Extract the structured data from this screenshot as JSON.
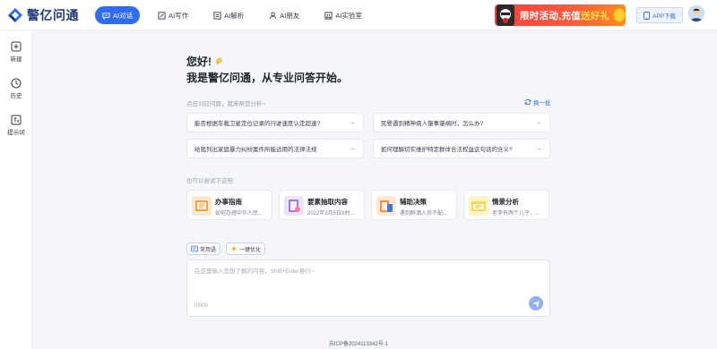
{
  "header": {
    "logo_text": "警亿问通",
    "nav": [
      {
        "label": "AI对话",
        "icon": "chat-bubble-icon",
        "active": true
      },
      {
        "label": "AI写作",
        "icon": "pen-icon",
        "active": false
      },
      {
        "label": "AI解析",
        "icon": "document-icon",
        "active": false
      },
      {
        "label": "AI朋友",
        "icon": "users-icon",
        "active": false
      },
      {
        "label": "AI实验室",
        "icon": "lab-icon",
        "active": false
      }
    ],
    "promo": {
      "text_main": "限时活动,充值",
      "text_highlight": "送好礼"
    },
    "app_download": "APP下载"
  },
  "sidebar": {
    "items": [
      {
        "label": "新建",
        "icon": "new-chat-icon"
      },
      {
        "label": "历史",
        "icon": "history-icon"
      },
      {
        "label": "提示词",
        "icon": "prompt-icon"
      }
    ]
  },
  "main": {
    "greeting_line1": "您好!",
    "greeting_line2": "我是警亿问通，从专业问答开始。",
    "question_hint": "点击对应问题，我来帮您分析~",
    "refresh_label": "换一批",
    "questions": [
      "能否根据车载卫星定位记录的行驶速度认定超速?",
      "民警遇到精神病人肇事肇祸时，怎么办?",
      "给我列出家庭暴力纠纷案件所能适用的法律法规",
      "如何理解切实维护特定群体合法权益这句话的含义?"
    ],
    "try_label": "也可以尝试下这些:",
    "features": [
      {
        "title": "办事指南",
        "subtitle": "如何办理中华人民..."
      },
      {
        "title": "要素抽取内容",
        "subtitle": "2022年3月5日8时..."
      },
      {
        "title": "辅助决策",
        "subtitle": "遇到醉酒人员不配..."
      },
      {
        "title": "情景分析",
        "subtitle": "老李有两个儿子，..."
      }
    ],
    "chips": [
      {
        "label": "常用语",
        "icon": "phrase-icon"
      },
      {
        "label": "一键优化",
        "icon": "sparkle-icon"
      }
    ],
    "input_placeholder": "在这里输入您想了解的内容，Shift+Enter换行~",
    "input_value": "",
    "char_counter": "0/500"
  },
  "footer": {
    "icp": "苏ICP备2024113342号-1"
  },
  "colors": {
    "accent": "#2f6cf5",
    "background": "#f4f6fa",
    "promo_red": "#ff3e3e"
  }
}
